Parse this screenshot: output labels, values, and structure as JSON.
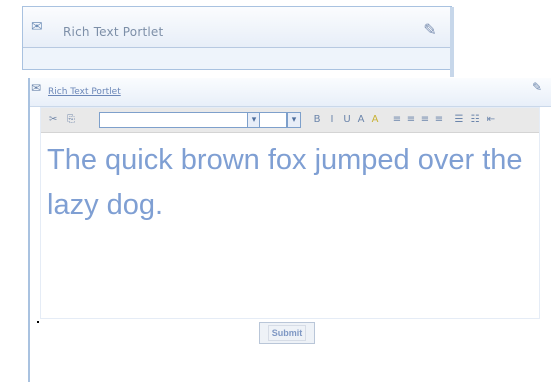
{
  "portlet_top": {
    "title": "Rich Text Portlet",
    "icon": "portlet-icon",
    "settings_icon": "settings-icon"
  },
  "portlet_main": {
    "title": "Rich Text Portlet",
    "icon": "portlet-icon",
    "settings_icon": "settings-icon"
  },
  "editor": {
    "font_value": "",
    "size_value": "",
    "content_text": "The quick brown fox jumped over the lazy dog."
  },
  "submit": {
    "label": "Submit"
  }
}
